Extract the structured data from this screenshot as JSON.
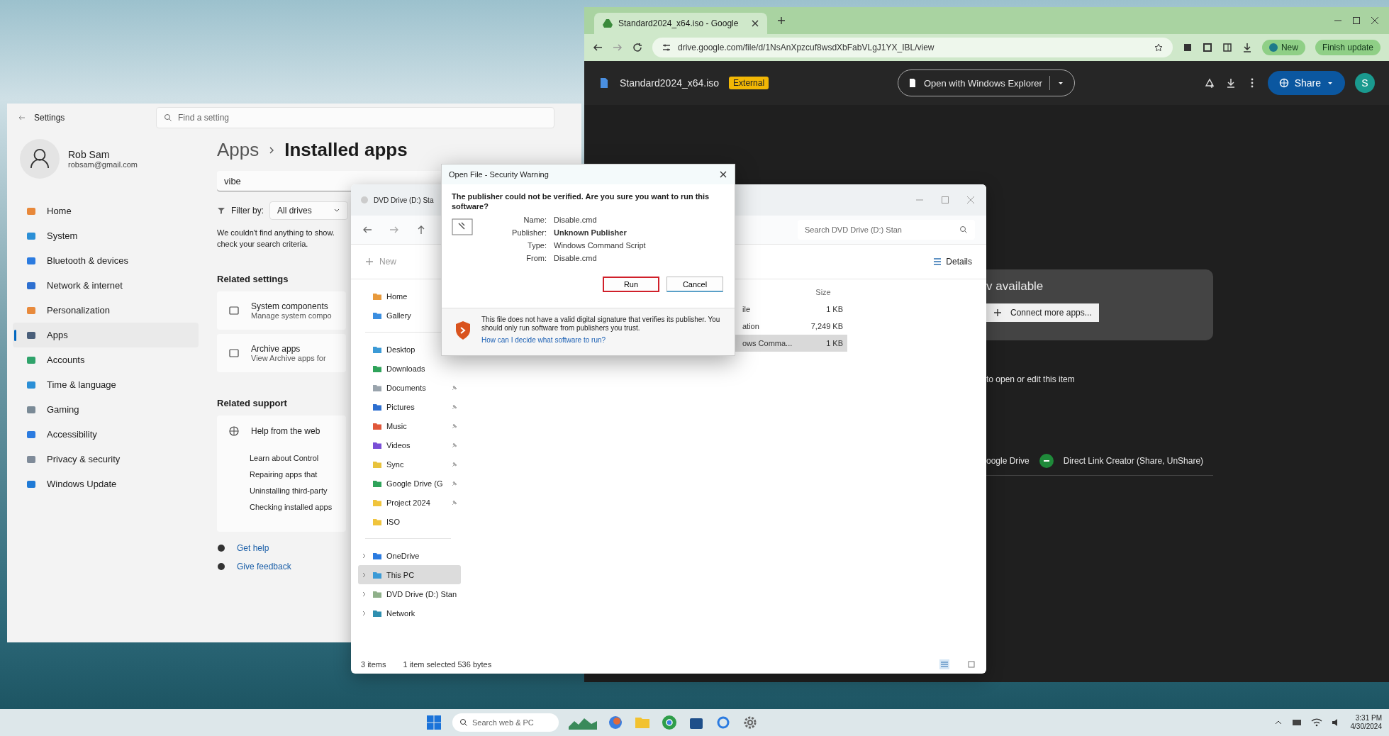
{
  "settings": {
    "title": "Settings",
    "search": {
      "placeholder": "Find a setting"
    },
    "user": {
      "name": "Rob Sam",
      "email": "robsam@gmail.com"
    },
    "nav": [
      {
        "label": "Home",
        "selected": false
      },
      {
        "label": "System",
        "selected": false
      },
      {
        "label": "Bluetooth & devices",
        "selected": false
      },
      {
        "label": "Network & internet",
        "selected": false
      },
      {
        "label": "Personalization",
        "selected": false
      },
      {
        "label": "Apps",
        "selected": true
      },
      {
        "label": "Accounts",
        "selected": false
      },
      {
        "label": "Time & language",
        "selected": false
      },
      {
        "label": "Gaming",
        "selected": false
      },
      {
        "label": "Accessibility",
        "selected": false
      },
      {
        "label": "Privacy & security",
        "selected": false
      },
      {
        "label": "Windows Update",
        "selected": false
      }
    ],
    "breadcrumb": {
      "parent": "Apps",
      "current": "Installed apps"
    },
    "app_search": {
      "value": "vibe"
    },
    "filter": {
      "label": "Filter by:",
      "value": "All drives"
    },
    "message_lines": [
      "We couldn't find anything to show.",
      "check your search criteria."
    ],
    "related_settings": {
      "heading": "Related settings",
      "items": [
        {
          "title": "System components",
          "subtitle": "Manage system compo"
        },
        {
          "title": "Archive apps",
          "subtitle": "View Archive apps for"
        }
      ]
    },
    "related_support": {
      "heading": "Related support",
      "title": "Help from the web",
      "links": [
        "Learn about Control",
        "Repairing apps that",
        "Uninstalling third-party",
        "Checking installed apps"
      ]
    },
    "footer_links": [
      "Get help",
      "Give feedback"
    ]
  },
  "explorer": {
    "title": "DVD Drive (D:) Sta",
    "search": {
      "placeholder": "Search DVD Drive (D:) Stan"
    },
    "new_button": "New",
    "view_button": "Details",
    "nav": [
      {
        "label": "Home",
        "kind": "item",
        "pinned": false,
        "selected": false
      },
      {
        "label": "Gallery",
        "kind": "item",
        "pinned": false,
        "selected": false
      },
      {
        "label": "Desktop",
        "kind": "item",
        "pinned": false,
        "selected": false
      },
      {
        "label": "Downloads",
        "kind": "item",
        "pinned": false,
        "selected": false
      },
      {
        "label": "Documents",
        "kind": "item",
        "pinned": true,
        "selected": false
      },
      {
        "label": "Pictures",
        "kind": "item",
        "pinned": true,
        "selected": false
      },
      {
        "label": "Music",
        "kind": "item",
        "pinned": true,
        "selected": false
      },
      {
        "label": "Videos",
        "kind": "item",
        "pinned": true,
        "selected": false
      },
      {
        "label": "Sync",
        "kind": "item",
        "pinned": true,
        "selected": false
      },
      {
        "label": "Google Drive (G",
        "kind": "item",
        "pinned": true,
        "selected": false
      },
      {
        "label": "Project 2024",
        "kind": "item",
        "pinned": true,
        "selected": false
      },
      {
        "label": "ISO",
        "kind": "item",
        "pinned": false,
        "selected": false
      },
      {
        "label": "OneDrive",
        "kind": "location",
        "expanded": false,
        "selected": false
      },
      {
        "label": "This PC",
        "kind": "location",
        "expanded": false,
        "selected": true
      },
      {
        "label": "DVD Drive (D:) Stan",
        "kind": "location",
        "expanded": false,
        "selected": false
      },
      {
        "label": "Network",
        "kind": "location",
        "expanded": false,
        "selected": false
      }
    ],
    "columns": [
      "Size"
    ],
    "rows": [
      {
        "type": "ile",
        "size": "1 KB",
        "selected": false
      },
      {
        "type": "ation",
        "size": "7,249 KB",
        "selected": false
      },
      {
        "type": "ows Comma...",
        "size": "1 KB",
        "selected": true
      }
    ],
    "status": {
      "count": "3 items",
      "selection": "1 item selected  536 bytes"
    }
  },
  "dialog": {
    "title": "Open File - Security Warning",
    "question": "The publisher could not be verified. Are you sure you want to run this software?",
    "fields": [
      {
        "label": "Name:",
        "value": "Disable.cmd",
        "bold": false
      },
      {
        "label": "Publisher:",
        "value": "Unknown Publisher",
        "bold": true
      },
      {
        "label": "Type:",
        "value": "Windows Command Script",
        "bold": false
      },
      {
        "label": "From:",
        "value": "Disable.cmd",
        "bold": false
      }
    ],
    "buttons": [
      {
        "label": "Run",
        "highlighted": true
      },
      {
        "label": "Cancel",
        "highlighted": false
      }
    ],
    "warning": "This file does not have a valid digital signature that verifies its publisher. You should only run software from publishers you trust.",
    "link": "How can I decide what software to run?"
  },
  "browser": {
    "tab": {
      "title": "Standard2024_x64.iso - Google"
    },
    "url": "drive.google.com/file/d/1NsAnXpzcuf8wsdXbFabVLgJ1YX_IBL/view",
    "profile_chip": "New",
    "update_chip": "Finish update",
    "file": {
      "name": "Standard2024_x64.iso",
      "badge": "External"
    },
    "open_with": "Open with Windows Explorer",
    "share": "Share",
    "avatar": "S",
    "panel": {
      "heading": "v available",
      "button": "Connect more apps..."
    },
    "hint": "to open or edit this item",
    "apps": [
      "oogle Drive",
      "Direct Link Creator (Share, UnShare)"
    ]
  },
  "taskbar": {
    "search": {
      "placeholder": "Search web & PC"
    },
    "time": "3:31 PM",
    "date": "4/30/2024"
  }
}
